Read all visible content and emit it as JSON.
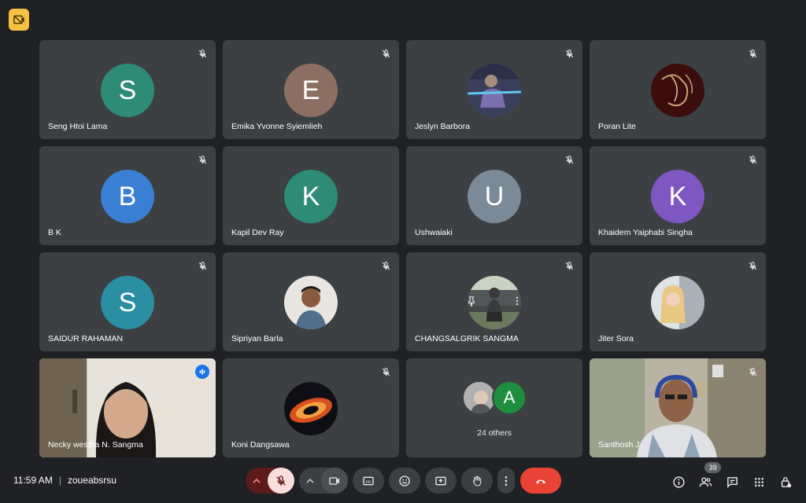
{
  "meeting": {
    "time": "11:59 AM",
    "code": "zoueabsrsu",
    "participant_count": "39"
  },
  "colors": {
    "background": "#202124",
    "tile": "#3c4043",
    "active_outline": "#8ab4f8",
    "end_call": "#ea4335",
    "mic_off_bg": "#f28b82",
    "badge": "#f6c244"
  },
  "tiles": [
    {
      "name": "Seng Htoi Lama",
      "initial": "S",
      "color": "#2e8b78",
      "muted": true
    },
    {
      "name": "Emika Yvonne Syiemlieh",
      "initial": "E",
      "color": "#8d6e63",
      "muted": true
    },
    {
      "name": "Jeslyn Barbora",
      "initial": "",
      "color": "",
      "muted": true,
      "photo": true
    },
    {
      "name": "Poran Lite",
      "initial": "",
      "color": "",
      "muted": true,
      "photo": true
    },
    {
      "name": "B K",
      "initial": "B",
      "color": "#3b7fd4",
      "muted": true
    },
    {
      "name": "Kapil Dev Ray",
      "initial": "K",
      "color": "#2e8b78",
      "muted": false
    },
    {
      "name": "Ushwaiaki",
      "initial": "U",
      "color": "#7b8a97",
      "muted": true
    },
    {
      "name": "Khaidem Yaiphabi Singha",
      "initial": "K",
      "color": "#7e57c2",
      "muted": true
    },
    {
      "name": "SAIDUR RAHAMAN",
      "initial": "S",
      "color": "#2a8fa3",
      "muted": true
    },
    {
      "name": "Sipriyan Barla",
      "initial": "",
      "color": "",
      "muted": true,
      "photo": true
    },
    {
      "name": "CHANGSALGRIK SANGMA",
      "initial": "",
      "color": "",
      "muted": true,
      "photo": true
    },
    {
      "name": "Jiter Sora",
      "initial": "",
      "color": "",
      "muted": true,
      "photo": true
    },
    {
      "name": "Necky westha N. Sangma",
      "speaking": true
    },
    {
      "name": "Koni Dangsawa",
      "initial": "",
      "color": "",
      "muted": true,
      "photo": true
    },
    {
      "others_label": "24 others",
      "initial": "A"
    },
    {
      "name": "Santhosh J",
      "muted": true
    }
  ],
  "icons": {
    "top_badge": "no-camera-icon",
    "mic": "mic-off-icon",
    "camera": "camera-icon",
    "captions": "captions-icon",
    "emoji": "emoji-icon",
    "present": "present-screen-icon",
    "hand": "raise-hand-icon",
    "more": "more-vert-icon",
    "end": "call-end-icon",
    "info": "info-icon",
    "people": "people-icon",
    "chat": "chat-icon",
    "activities": "apps-grid-icon",
    "host": "host-controls-icon"
  }
}
